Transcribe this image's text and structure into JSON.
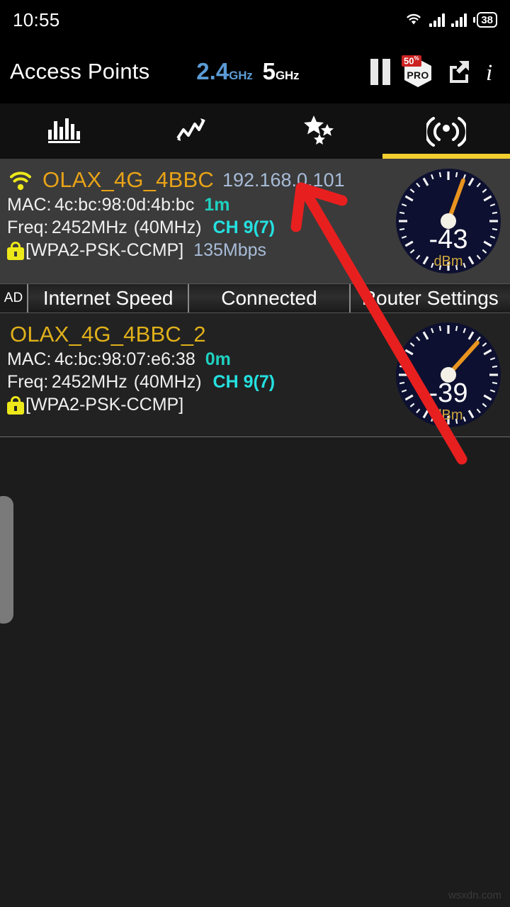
{
  "status_bar": {
    "clock": "10:55",
    "battery_level": "38",
    "icons": [
      "wifi-icon",
      "signal-bars-icon",
      "signal-bars-icon",
      "battery-icon"
    ]
  },
  "header": {
    "title": "Access Points",
    "bands": [
      {
        "num": "2.4",
        "unit": "GHz",
        "active": true
      },
      {
        "num": "5",
        "unit": "GHz",
        "active": false
      }
    ],
    "accent_active": "#5b9bd5",
    "icons": {
      "pause": "pause-icon",
      "pro_label": "PRO",
      "pro_discount": "50",
      "pro_discount_suffix": "%",
      "share": "share-icon",
      "info": "info-icon"
    }
  },
  "tabs": {
    "items": [
      {
        "icon": "bar-chart-icon",
        "selected": false
      },
      {
        "icon": "time-graph-icon",
        "selected": false
      },
      {
        "icon": "stars-icon",
        "selected": false
      },
      {
        "icon": "signal-radar-icon",
        "selected": true
      }
    ],
    "indicator_color": "#f2cf2f"
  },
  "access_points": [
    {
      "has_wifi_icon": true,
      "ssid": "OLAX_4G_4BBC",
      "ip": "192.168.0.101",
      "mac_label": "MAC:",
      "mac": "4c:bc:98:0d:4b:bc",
      "distance": "1m",
      "freq_label": "Freq:",
      "freq": "2452MHz",
      "width": "(40MHz)",
      "channel": "CH 9(7)",
      "security": "[WPA2-PSK-CCMP]",
      "rate": "135Mbps",
      "signal_value": "-43",
      "signal_unit": "dBm",
      "needle_deg": 20
    },
    {
      "has_wifi_icon": false,
      "ssid": "OLAX_4G_4BBC_2",
      "ip": "",
      "mac_label": "MAC:",
      "mac": "4c:bc:98:07:e6:38",
      "distance": "0m",
      "freq_label": "Freq:",
      "freq": "2452MHz",
      "width": "(40MHz)",
      "channel": "CH 9(7)",
      "security": "[WPA2-PSK-CCMP]",
      "rate": "",
      "signal_value": "-39",
      "signal_unit": "dBm",
      "needle_deg": 42
    }
  ],
  "ad_bar": {
    "tag": "AD",
    "segments": [
      "Internet Speed",
      "Connected",
      "Router Settings"
    ]
  },
  "annotation": {
    "arrow_color": "#e81f1f"
  },
  "watermark": "wsxdn.com"
}
